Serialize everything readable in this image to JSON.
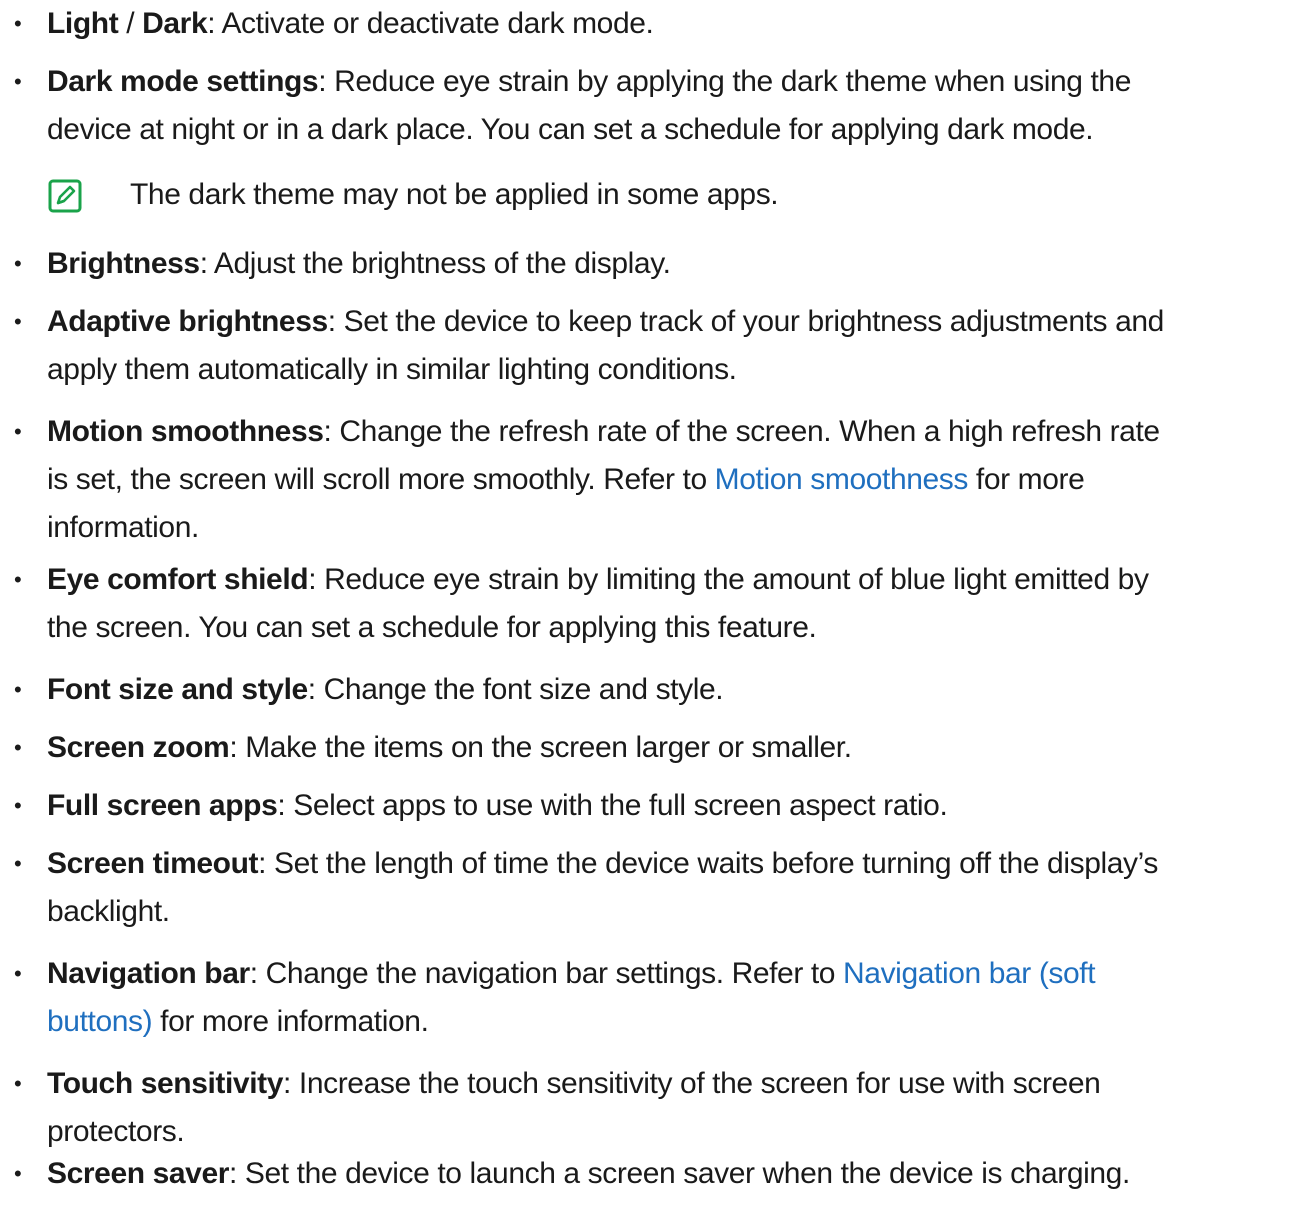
{
  "items": [
    {
      "lines": [
        {
          "term": "Light",
          "sep": " / ",
          "term2": "Dark",
          "rest": ": Activate or deactivate dark mode."
        }
      ]
    },
    {
      "lines": [
        {
          "term": "Dark mode settings",
          "rest": ": Reduce eye strain by applying the dark theme when using the"
        },
        {
          "rest": "device at night or in a dark place. You can set a schedule for applying dark mode."
        }
      ]
    },
    {
      "lines": [
        {
          "term": "Brightness",
          "rest": ": Adjust the brightness of the display."
        }
      ]
    },
    {
      "lines": [
        {
          "term": "Adaptive brightness",
          "rest": ": Set the device to keep track of your brightness adjustments and"
        },
        {
          "rest": "apply them automatically in similar lighting conditions."
        }
      ]
    },
    {
      "lines": [
        {
          "term": "Motion smoothness",
          "rest": ": Change the refresh rate of the screen. When a high refresh rate"
        },
        {
          "rest": "is set, the screen will scroll more smoothly. Refer to ",
          "link": "Motion smoothness",
          "after": " for more"
        },
        {
          "rest": "information."
        }
      ]
    },
    {
      "lines": [
        {
          "term": "Eye comfort shield",
          "rest": ": Reduce eye strain by limiting the amount of blue light emitted by"
        },
        {
          "rest": "the screen. You can set a schedule for applying this feature."
        }
      ]
    },
    {
      "lines": [
        {
          "term": "Font size and style",
          "rest": ": Change the font size and style."
        }
      ]
    },
    {
      "lines": [
        {
          "term": "Screen zoom",
          "rest": ": Make the items on the screen larger or smaller."
        }
      ]
    },
    {
      "lines": [
        {
          "term": "Full screen apps",
          "rest": ": Select apps to use with the full screen aspect ratio."
        }
      ]
    },
    {
      "lines": [
        {
          "term": "Screen timeout",
          "rest": ": Set the length of time the device waits before turning off the display’s"
        },
        {
          "rest": "backlight."
        }
      ]
    },
    {
      "lines": [
        {
          "term": "Navigation bar",
          "rest": ": Change the navigation bar settings. Refer to ",
          "link": "Navigation bar (soft"
        },
        {
          "link": "buttons)",
          "after": " for more information."
        }
      ]
    },
    {
      "lines": [
        {
          "term": "Touch sensitivity",
          "rest": ": Increase the touch sensitivity of the screen for use with screen"
        },
        {
          "rest": "protectors."
        }
      ]
    },
    {
      "lines": [
        {
          "term": "Screen saver",
          "rest": ": Set the device to launch a screen saver when the device is charging."
        }
      ]
    }
  ],
  "bullet_char": "•",
  "note": {
    "text": "The dark theme may not be applied in some apps.",
    "icon": "note-pencil-icon"
  },
  "colors": {
    "link": "#1f6fbf",
    "note_icon": "#1aa34a",
    "text": "#1a1a1a"
  }
}
